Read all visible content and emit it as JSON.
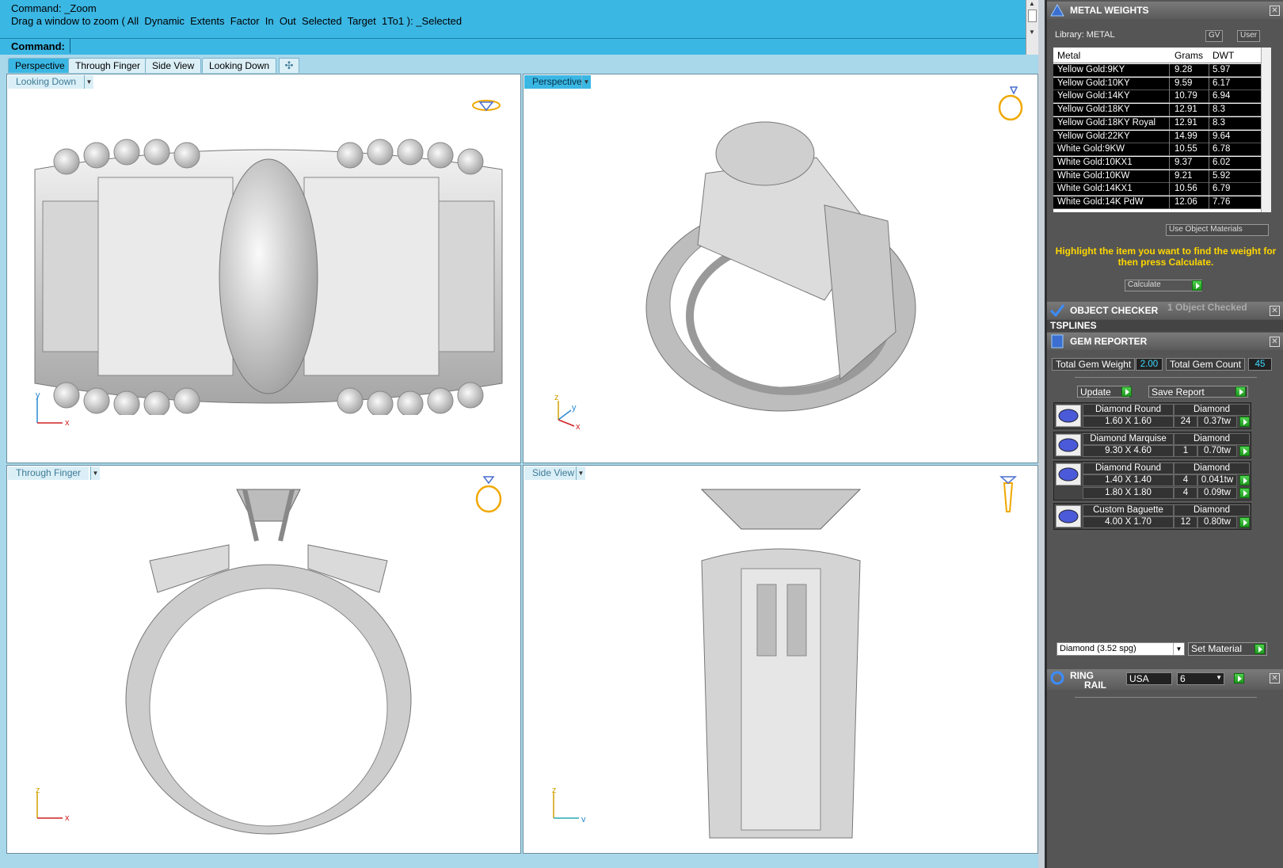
{
  "command": {
    "history": [
      "Command: _Zoom",
      "Drag a window to zoom ( All  Dynamic  Extents  Factor  In  Out  Selected  Target  1To1 ): _Selected"
    ],
    "prompt_label": "Command:"
  },
  "tabs": [
    {
      "label": "Perspective",
      "active": true
    },
    {
      "label": "Through Finger",
      "active": false
    },
    {
      "label": "Side View",
      "active": false
    },
    {
      "label": "Looking Down",
      "active": false
    }
  ],
  "tab_add_symbol": "✣",
  "viewports": {
    "top_left": {
      "title": "Looking Down",
      "axis_x": "x",
      "axis_y": "y"
    },
    "top_right": {
      "title": "Perspective",
      "axis_x": "x",
      "axis_y": "y",
      "axis_z": "z"
    },
    "bottom_left": {
      "title": "Through Finger",
      "axis_x": "x",
      "axis_z": "z"
    },
    "bottom_right": {
      "title": "Side View",
      "axis_y": "y",
      "axis_z": "z"
    }
  },
  "metal_weights": {
    "title": "METAL WEIGHTS",
    "library_label": "Library: METAL",
    "gv_label": "GV",
    "user_label": "User",
    "columns": [
      "Metal",
      "Grams",
      "DWT"
    ],
    "rows": [
      [
        "Yellow Gold:9KY",
        "9.28",
        "5.97"
      ],
      [
        "Yellow Gold:10KY",
        "9.59",
        "6.17"
      ],
      [
        "Yellow Gold:14KY",
        "10.79",
        "6.94"
      ],
      [
        "Yellow Gold:18KY",
        "12.91",
        "8.3"
      ],
      [
        "Yellow Gold:18KY Royal",
        "12.91",
        "8.3"
      ],
      [
        "Yellow Gold:22KY",
        "14.99",
        "9.64"
      ],
      [
        "White Gold:9KW",
        "10.55",
        "6.78"
      ],
      [
        "White Gold:10KX1",
        "9.37",
        "6.02"
      ],
      [
        "White Gold:10KW",
        "9.21",
        "5.92"
      ],
      [
        "White Gold:14KX1",
        "10.56",
        "6.79"
      ],
      [
        "White Gold:14K PdW",
        "12.06",
        "7.76"
      ]
    ],
    "use_object_materials": "Use Object Materials",
    "instruction": "Highlight the item you want to find the weight for then press Calculate.",
    "calculate_label": "Calculate"
  },
  "object_checker": {
    "title": "OBJECT CHECKER",
    "status": "1 Object Checked"
  },
  "tsplines": {
    "title": "TSPLINES"
  },
  "gem_reporter": {
    "title": "GEM REPORTER",
    "total_weight_label": "Total Gem Weight",
    "total_weight_value": "2.00",
    "total_count_label": "Total Gem Count",
    "total_count_value": "45",
    "update_label": "Update",
    "save_report_label": "Save Report",
    "gems": [
      {
        "shape": "Diamond Round",
        "material": "Diamond",
        "sizes": [
          {
            "size": "1.60 X 1.60",
            "count": "24",
            "weight": "0.37tw"
          }
        ]
      },
      {
        "shape": "Diamond Marquise",
        "material": "Diamond",
        "sizes": [
          {
            "size": "9.30 X 4.60",
            "count": "1",
            "weight": "0.70tw"
          }
        ]
      },
      {
        "shape": "Diamond Round",
        "material": "Diamond",
        "sizes": [
          {
            "size": "1.40 X 1.40",
            "count": "4",
            "weight": "0.041tw"
          },
          {
            "size": "1.80 X 1.80",
            "count": "4",
            "weight": "0.09tw"
          }
        ]
      },
      {
        "shape": "Custom Baguette",
        "material": "Diamond",
        "sizes": [
          {
            "size": "4.00 X 1.70",
            "count": "12",
            "weight": "0.80tw"
          }
        ]
      }
    ],
    "material_select": "Diamond     (3.52 spg)",
    "set_material_label": "Set Material"
  },
  "ring_rail": {
    "title_line1": "RING",
    "title_line2": "RAIL",
    "region": "USA",
    "size": "6"
  },
  "colors": {
    "accent": "#3bb7e4",
    "panel_bg": "#555555",
    "highlight_text": "#ffd700",
    "value_text": "#3bd8ff"
  }
}
